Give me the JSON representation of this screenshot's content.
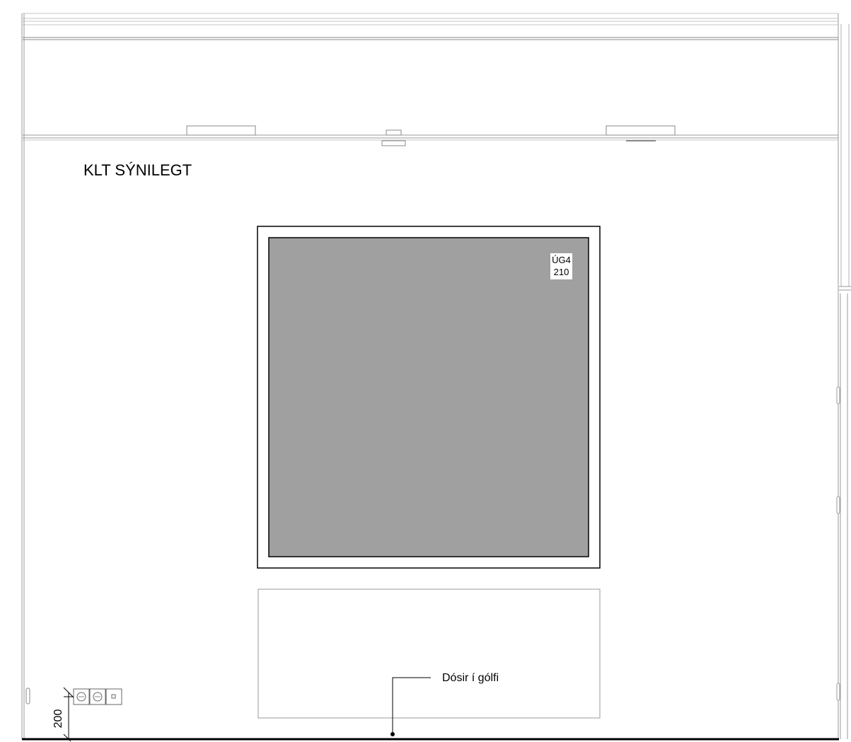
{
  "drawing": {
    "title": "KLT SÝNILEGT",
    "window_tag": {
      "code": "ÚG4",
      "number": "210"
    },
    "floor_box_note": "Dósir í gólfi",
    "outlet_height_dimension": "200"
  },
  "colors": {
    "line": "#000000",
    "light_line": "#9a9a9a",
    "glass_fill": "#a0a0a0",
    "background": "#ffffff"
  }
}
